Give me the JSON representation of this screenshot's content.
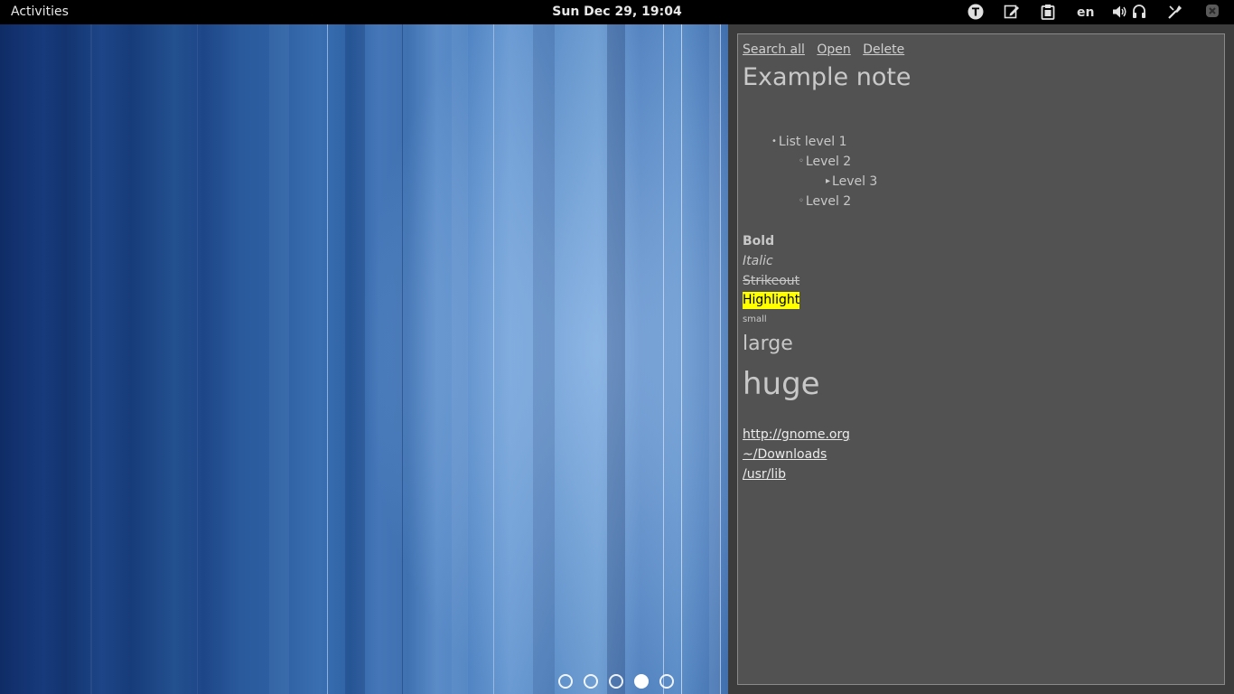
{
  "topbar": {
    "activities_label": "Activities",
    "clock": "Sun Dec 29, 19:04",
    "tray": {
      "tomboy_icon": "tomboy-note-icon",
      "edit_icon": "edit-document-icon",
      "clipboard_icon": "clipboard-icon",
      "language": "en",
      "volume_icon": "volume-icon",
      "headphones_icon": "headphones-icon",
      "tools_icon": "tools-icon",
      "close_icon": "close-icon"
    }
  },
  "desktop": {
    "workspaces": {
      "count": 5,
      "active_index": 3
    }
  },
  "note": {
    "actions": {
      "search_all": "Search all",
      "open": "Open",
      "delete": "Delete"
    },
    "title": "Example note",
    "list": [
      {
        "bullet": "•",
        "text": "List level 1"
      },
      {
        "bullet": "◦",
        "text": "Level 2"
      },
      {
        "bullet": "▸",
        "text": "Level 3"
      },
      {
        "bullet": "◦",
        "text": "Level 2"
      }
    ],
    "formatting": {
      "bold": "Bold",
      "italic": "Italic",
      "strikeout": "Strikeout",
      "highlight": "Highlight",
      "small": "small",
      "large": "large",
      "huge": "huge"
    },
    "links": [
      "http://gnome.org",
      "~/Downloads",
      "/usr/lib"
    ]
  },
  "colors": {
    "topbar_bg": "#000000",
    "note_bg": "#525252",
    "highlight_bg": "#ffff00",
    "highlight_text": "#000000"
  }
}
